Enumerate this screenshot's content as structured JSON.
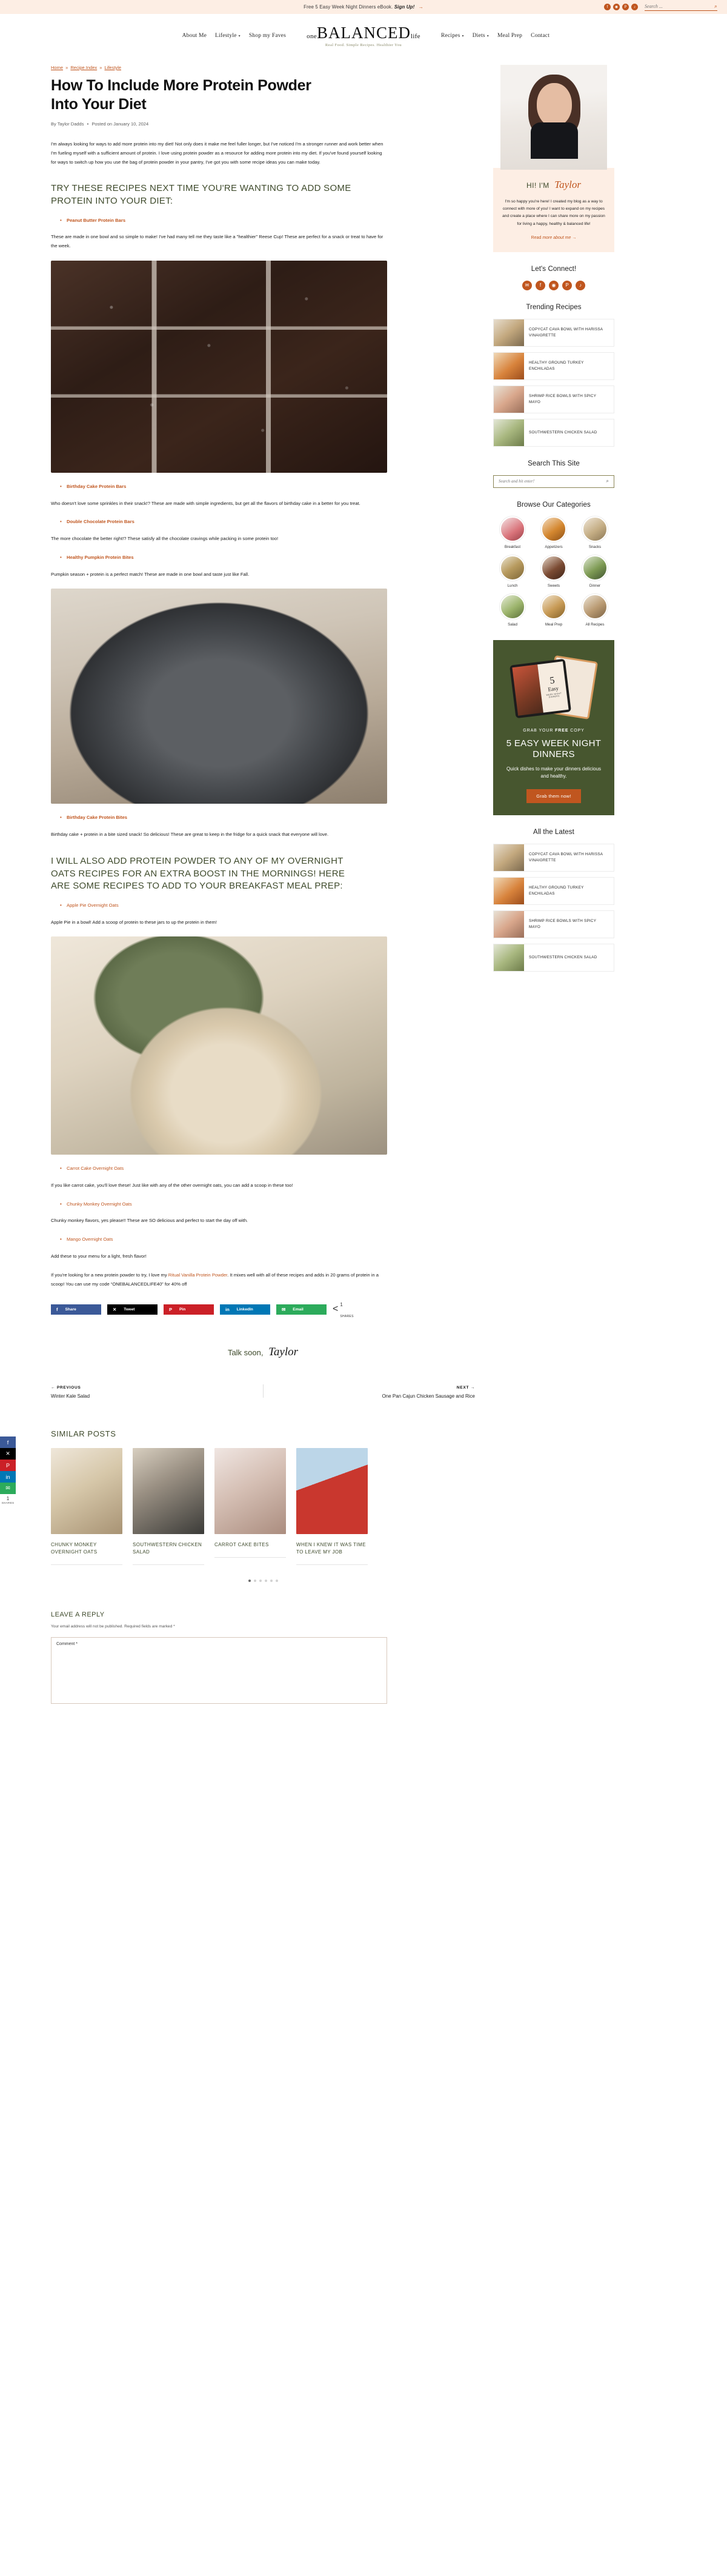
{
  "topbar": {
    "message_prefix": "Free 5 Easy Week Night Dinners eBook.",
    "message_link": "Sign Up!",
    "arrow": "→",
    "socials": [
      {
        "name": "facebook-icon",
        "glyph": "f"
      },
      {
        "name": "instagram-icon",
        "glyph": "◉"
      },
      {
        "name": "pinterest-icon",
        "glyph": "P"
      },
      {
        "name": "tiktok-icon",
        "glyph": "♪"
      }
    ],
    "search_placeholder": "Search ...",
    "search_value": ""
  },
  "nav": {
    "left": [
      {
        "label": "About Me",
        "has_caret": false
      },
      {
        "label": "Lifestyle",
        "has_caret": true
      },
      {
        "label": "Shop my Faves",
        "has_caret": false
      }
    ],
    "right": [
      {
        "label": "Recipes",
        "has_caret": true
      },
      {
        "label": "Diets",
        "has_caret": true
      },
      {
        "label": "Meal Prep",
        "has_caret": false
      },
      {
        "label": "Contact",
        "has_caret": false
      }
    ],
    "logo_one": "one",
    "logo_main": "BALANCED",
    "logo_life": "life",
    "logo_tagline": "Real Food. Simple Recipes. Healthier You"
  },
  "article": {
    "breadcrumb": [
      {
        "label": "Home"
      },
      {
        "label": "Recipe Index"
      },
      {
        "label": "Lifestyle"
      }
    ],
    "breadcrumb_sep": "»",
    "title": "How To Include More Protein Powder Into Your Diet",
    "byline_author": "By Taylor Dadds",
    "byline_dot": "•",
    "byline_date": "Posted on January 10, 2024",
    "intro": "I'm always looking for ways to add more protein into my diet! Not only does it make me feel fuller longer, but I've noticed I'm a stronger runner and work better when I'm fueling myself with a sufficient amount of protein. I love using protein powder as a resource for adding more protein into my diet. If you've found yourself looking for ways to switch up how you use the bag of protein powder in your pantry, I've got you with some recipe ideas you can make today.",
    "heading_1": "TRY THESE RECIPES NEXT TIME YOU'RE WANTING TO ADD SOME PROTEIN INTO YOUR DIET:",
    "link_1": "Peanut Butter Protein Bars",
    "para_1": "These are made in one bowl and so simple to make! I've had many tell me they taste like a \"healthier\" Reese Cup! These are perfect for a snack or treat to have for the week.",
    "photo_1_alt": "Chocolate topped protein bars cut into squares with flaky salt",
    "link_2": "Birthday Cake Protein Bars",
    "para_2": "Who doesn't love some sprinkles in their snack!? These are made with simple ingredients, but get all the flavors of birthday cake in a better for you treat.",
    "link_3": "Double Chocolate Protein Bars",
    "para_3": "The more chocolate the better right!? These satisfy all the chocolate cravings while packing in some protein too!",
    "link_4": "Healthy Pumpkin Protein Bites",
    "para_4": "Pumpkin season + protein is a perfect match! These are made in one bowl and taste just like Fall.",
    "photo_2_alt": "Plate of birthday cake protein bites with sprinkles",
    "link_5": "Birthday Cake Protein Bites",
    "para_5": "Birthday cake + protein in a bite sized snack! So delicious! These are great to keep in the fridge for a quick snack that everyone will love.",
    "heading_2": "I WILL ALSO ADD PROTEIN POWDER TO ANY OF MY OVERNIGHT OATS RECIPES FOR AN EXTRA BOOST IN THE MORNINGS! HERE ARE SOME RECIPES TO ADD TO YOUR BREAKFAST MEAL PREP:",
    "link_6": "Apple Pie Overnight Oats",
    "para_6": "Apple Pie in a bowl! Add a scoop of protein to these jars to up the protein in them!",
    "photo_3_alt": "Bowl of apple pie overnight oats with a wooden spoon",
    "link_7": "Carrot Cake Overnight Oats",
    "para_7": "If you like carrot cake, you'll love these! Just like with any of the other overnight oats, you can add a scoop in these too!",
    "link_8": "Chunky Monkey Overnight Oats",
    "para_8": "Chunky monkey flavors, yes please!! These are SO delicious and perfect to start the day off with.",
    "link_9": "Mango Overnight Oats",
    "para_9": "Add these to your menu for a light, fresh flavor!",
    "para_10_before": "If you're looking for a new protein powder to try, I love my ",
    "para_10_link": "Ritual Vanilla Protein Powder",
    "para_10_after": ". It mixes well with all of these recipes and adds in 20 grams of protein in a scoop! You can use my code “ONEBALANCEDLIFE40” for 40% off",
    "signoff_text": "Talk soon,",
    "signoff_name": "Taylor"
  },
  "share": {
    "buttons": [
      {
        "label": "Share",
        "icon": "facebook-icon",
        "glyph": "f",
        "cls": "sb-fb"
      },
      {
        "label": "Tweet",
        "icon": "x-twitter-icon",
        "glyph": "✕",
        "cls": "sb-tw"
      },
      {
        "label": "Pin",
        "icon": "pinterest-icon",
        "glyph": "P",
        "cls": "sb-pin"
      },
      {
        "label": "LinkedIn",
        "icon": "linkedin-icon",
        "glyph": "in",
        "cls": "sb-li"
      },
      {
        "label": "Email",
        "icon": "email-icon",
        "glyph": "✉",
        "cls": "sb-em"
      }
    ],
    "count": "1",
    "count_label": "SHARES",
    "share_glyph": "<"
  },
  "rail": {
    "buttons": [
      {
        "icon": "facebook-icon",
        "glyph": "f",
        "cls": "rb-fb"
      },
      {
        "icon": "x-twitter-icon",
        "glyph": "✕",
        "cls": "rb-tw"
      },
      {
        "icon": "pinterest-icon",
        "glyph": "P",
        "cls": "rb-pin"
      },
      {
        "icon": "linkedin-icon",
        "glyph": "in",
        "cls": "rb-li"
      },
      {
        "icon": "email-icon",
        "glyph": "✉",
        "cls": "rb-em"
      }
    ],
    "count": "1",
    "count_label": "SHARES"
  },
  "post_nav": {
    "prev_kicker": "← PREVIOUS",
    "prev_title": "Winter Kale Salad",
    "next_kicker": "NEXT →",
    "next_title": "One Pan Cajun Chicken Sausage and Rice"
  },
  "similar": {
    "heading": "SIMILAR POSTS",
    "posts": [
      {
        "title": "CHUNKY MONKEY OVERNIGHT OATS",
        "cls": "si1"
      },
      {
        "title": "SOUTHWESTERN CHICKEN SALAD",
        "cls": "si2"
      },
      {
        "title": "CARROT CAKE BITES",
        "cls": "si3"
      },
      {
        "title": "WHEN I KNEW IT WAS TIME TO LEAVE MY JOB",
        "cls": "si4"
      }
    ],
    "dots": 6,
    "active_dot": 0
  },
  "comments": {
    "heading": "LEAVE A REPLY",
    "note": "Your email address will not be published. Required fields are marked *",
    "field_label": "Comment *",
    "value": ""
  },
  "sidebar": {
    "author": {
      "hi": "HI! I'M",
      "name": "Taylor",
      "text": "I'm so happy you're here! I created my blog as a way to connect with more of you! I want to expand on my recipes and create a place where I can share more on my passion for living a happy, healthy & balanced life!",
      "cta_plain": "Read",
      "cta_italic": " more about me",
      "cta_arrow": "→"
    },
    "connect": {
      "heading": "Let's Connect!",
      "socials": [
        {
          "name": "email-icon",
          "glyph": "✉"
        },
        {
          "name": "facebook-icon",
          "glyph": "f"
        },
        {
          "name": "instagram-icon",
          "glyph": "◉"
        },
        {
          "name": "pinterest-icon",
          "glyph": "P"
        },
        {
          "name": "tiktok-icon",
          "glyph": "♪"
        }
      ]
    },
    "trending": {
      "heading": "Trending Recipes",
      "items": [
        {
          "title": "COPYCAT CAVA BOWL WITH HARISSA VINAIGRETTE",
          "cls": "tt1"
        },
        {
          "title": "HEALTHY GROUND TURKEY ENCHILADAS",
          "cls": "tt2"
        },
        {
          "title": "SHRIMP RICE BOWLS WITH SPICY MAYO",
          "cls": "tt3"
        },
        {
          "title": "SOUTHWESTERN CHICKEN SALAD",
          "cls": "tt4"
        }
      ]
    },
    "search": {
      "heading": "Search This Site",
      "placeholder": "Search and hit enter!",
      "value": ""
    },
    "categories": {
      "heading": "Browse Our Categories",
      "items": [
        {
          "label": "Breakfast",
          "cls": "cc1"
        },
        {
          "label": "Appetizers",
          "cls": "cc2"
        },
        {
          "label": "Snacks",
          "cls": "cc3"
        },
        {
          "label": "Lunch",
          "cls": "cc4"
        },
        {
          "label": "Sweets",
          "cls": "cc5"
        },
        {
          "label": "Dinner",
          "cls": "cc6"
        },
        {
          "label": "Salad",
          "cls": "cc7"
        },
        {
          "label": "Meal Prep",
          "cls": "cc8"
        },
        {
          "label": "All Recipes",
          "cls": "cc9"
        }
      ]
    },
    "promo": {
      "kicker_before": "GRAB YOUR ",
      "kicker_bold": "FREE",
      "kicker_after": " COPY",
      "headline": "5 EASY WEEK NIGHT DINNERS",
      "sub": "Quick dishes to make your dinners delicious and healthy.",
      "button": "Grab them now!",
      "cover_number": "5",
      "cover_easy": "Easy",
      "cover_sub": "WEEK NIGHT DINNERS"
    },
    "latest": {
      "heading": "All the Latest",
      "items": [
        {
          "title": "COPYCAT CAVA BOWL WITH HARISSA VINAIGRETTE",
          "cls": "tt1"
        },
        {
          "title": "HEALTHY GROUND TURKEY ENCHILADAS",
          "cls": "tt2"
        },
        {
          "title": "SHRIMP RICE BOWLS WITH SPICY MAYO",
          "cls": "tt3"
        },
        {
          "title": "SOUTHWESTERN CHICKEN SALAD",
          "cls": "tt4"
        }
      ]
    }
  }
}
